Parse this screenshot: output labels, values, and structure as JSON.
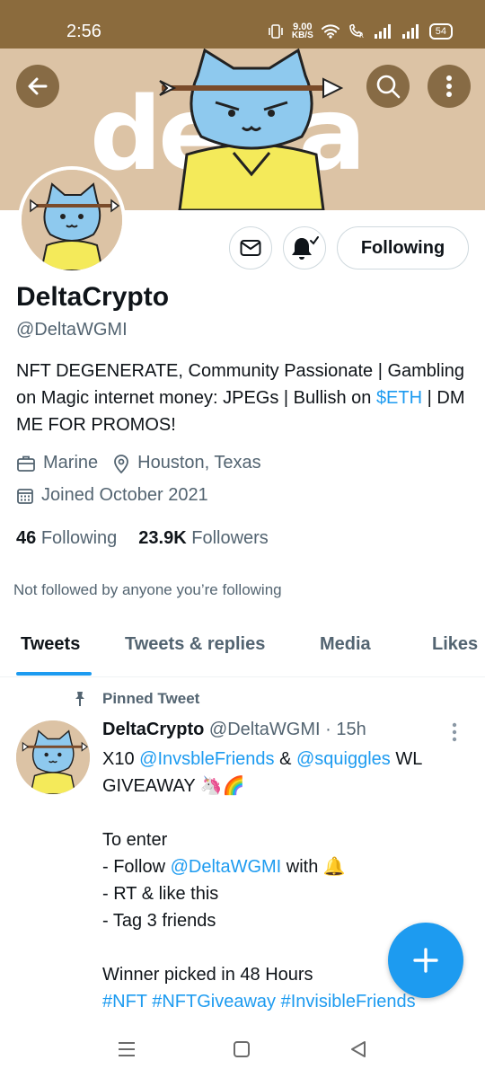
{
  "status_bar": {
    "time": "2:56",
    "net_rate": "9.00",
    "net_unit": "KB/S",
    "battery": "54"
  },
  "banner": {
    "wordmark": "delta"
  },
  "profile": {
    "display_name": "DeltaCrypto",
    "handle": "@DeltaWGMI",
    "following_button": "Following",
    "bio_part1": "NFT DEGENERATE, Community Passionate | Gambling on Magic internet money: JPEGs | Bullish on ",
    "bio_link": "$ETH",
    "bio_part2": " | DM ME FOR PROMOS!",
    "occupation": "Marine",
    "location": "Houston, Texas",
    "joined": "Joined October 2021",
    "following_count": "46",
    "following_label": "Following",
    "followers_count": "23.9K",
    "followers_label": "Followers",
    "not_followed": "Not followed by anyone you’re following"
  },
  "tabs": [
    {
      "label": "Tweets",
      "active": true
    },
    {
      "label": "Tweets & replies",
      "active": false
    },
    {
      "label": "Media",
      "active": false
    },
    {
      "label": "Likes",
      "active": false
    }
  ],
  "tweet": {
    "pinned_label": "Pinned Tweet",
    "author_name": "DeltaCrypto",
    "author_handle": "@DeltaWGMI",
    "separator": "·",
    "time": "15h",
    "line1_prefix": "X10 ",
    "mention1": "@InvsbleFriends",
    "amp": " & ",
    "mention2": "@squiggles",
    "line1_suffix": " WL",
    "line2": "GIVEAWAY 🦄🌈",
    "line3": "To enter",
    "line4_prefix": "- Follow ",
    "mention3": "@DeltaWGMI",
    "line4_suffix": " with 🔔",
    "line5": "- RT & like this",
    "line6": "- Tag 3 friends",
    "line7": "Winner picked in 48 Hours",
    "hashtag1": "#NFT",
    "hashtag2": "#NFTGiveaway",
    "hashtag3": "#InvisibleFriends"
  },
  "colors": {
    "accent": "#1d9bf0",
    "status_bar": "#8b6b3d",
    "banner": "#dcc3a5",
    "secondary_text": "#536471"
  }
}
